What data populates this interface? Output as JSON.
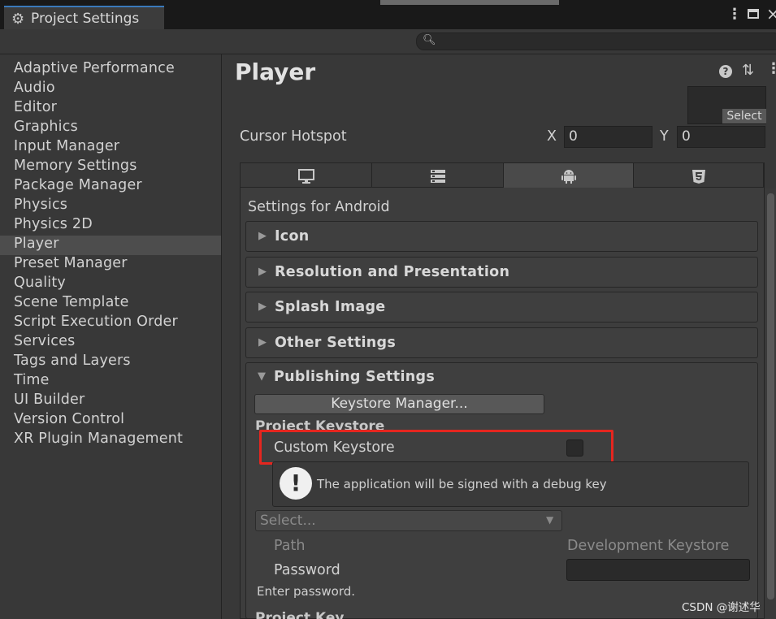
{
  "window": {
    "tab_title": "Project Settings",
    "tab_icon": "gear-icon"
  },
  "sidebar": {
    "items": [
      {
        "label": "Adaptive Performance"
      },
      {
        "label": "Audio"
      },
      {
        "label": "Editor"
      },
      {
        "label": "Graphics"
      },
      {
        "label": "Input Manager"
      },
      {
        "label": "Memory Settings"
      },
      {
        "label": "Package Manager"
      },
      {
        "label": "Physics"
      },
      {
        "label": "Physics 2D"
      },
      {
        "label": "Player",
        "selected": true
      },
      {
        "label": "Preset Manager"
      },
      {
        "label": "Quality"
      },
      {
        "label": "Scene Template"
      },
      {
        "label": "Script Execution Order"
      },
      {
        "label": "Services"
      },
      {
        "label": "Tags and Layers"
      },
      {
        "label": "Time"
      },
      {
        "label": "UI Builder"
      },
      {
        "label": "Version Control"
      },
      {
        "label": "XR Plugin Management"
      }
    ]
  },
  "main": {
    "title": "Player",
    "cursor_texture_button": "Select",
    "cursor_hotspot": {
      "label": "Cursor Hotspot",
      "x_label": "X",
      "x_value": "0",
      "y_label": "Y",
      "y_value": "0"
    },
    "platform_tabs": [
      {
        "icon": "monitor-icon",
        "active": false
      },
      {
        "icon": "server-icon",
        "active": false
      },
      {
        "icon": "android-icon",
        "active": true
      },
      {
        "icon": "html5-icon",
        "active": false
      }
    ],
    "settings_for": "Settings for Android",
    "sections": [
      {
        "label": "Icon",
        "expanded": false
      },
      {
        "label": "Resolution and Presentation",
        "expanded": false
      },
      {
        "label": "Splash Image",
        "expanded": false
      },
      {
        "label": "Other Settings",
        "expanded": false
      },
      {
        "label": "Publishing Settings",
        "expanded": true
      }
    ],
    "publishing": {
      "keystore_manager_button": "Keystore Manager...",
      "project_keystore_heading": "Project Keystore",
      "custom_keystore_label": "Custom Keystore",
      "custom_keystore_checked": false,
      "warning_text": "The application will be signed with a debug key",
      "select_placeholder": "Select...",
      "path_label": "Path",
      "dev_keystore_label": "Development Keystore",
      "password_label": "Password",
      "password_value": "",
      "enter_password_hint": "Enter password.",
      "project_key_heading": "Project Key"
    }
  },
  "colors": {
    "highlight_box": "#e5261f",
    "selection": "#4d4d4d",
    "active_tab_accent": "#3a79bb"
  },
  "watermark": "CSDN @谢述华"
}
